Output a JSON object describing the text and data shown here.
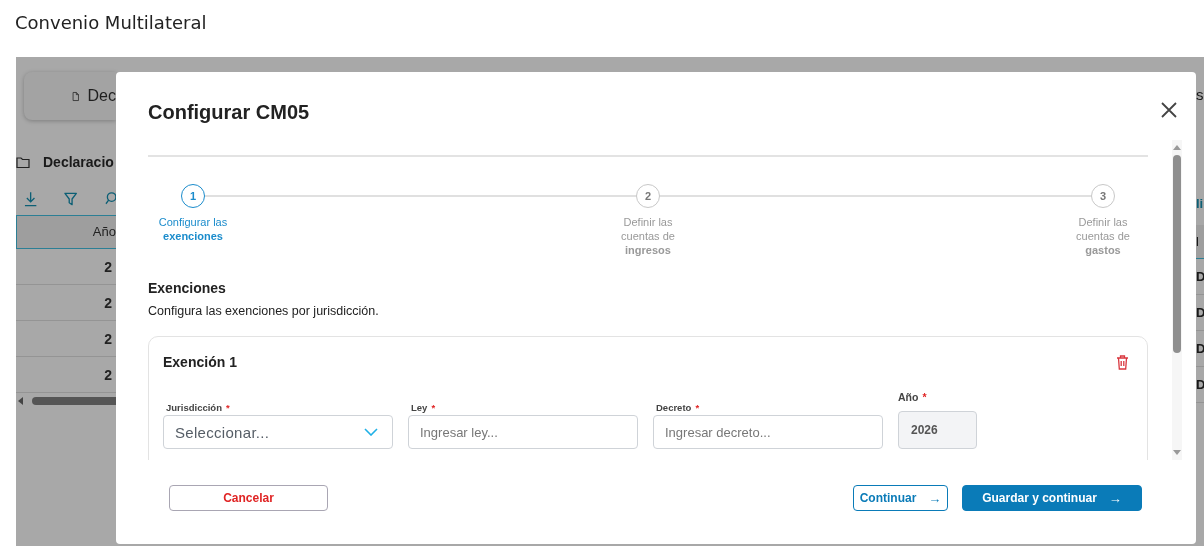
{
  "page": {
    "title": "Convenio Multilateral"
  },
  "background": {
    "card_label": "Dec",
    "section_title": "Declaracio",
    "table_header": "Año",
    "rows": [
      "2",
      "2",
      "2",
      "2"
    ],
    "right_card_text": "s",
    "right_link": "li",
    "right_header": "l",
    "right_rows": [
      "D",
      "D",
      "D",
      "D"
    ]
  },
  "modal": {
    "title": "Configurar CM05",
    "steps": [
      {
        "number": "1",
        "label": "Configurar las **exenciones**",
        "selected": true
      },
      {
        "number": "2",
        "label": "Definir las cuentas de **ingresos**",
        "selected": false
      },
      {
        "number": "3",
        "label": "Definir las cuentas de **gastos**",
        "selected": false
      }
    ],
    "section": {
      "title": "Exenciones",
      "description": "Configura las exenciones por jurisdicción."
    },
    "exemptions": [
      {
        "title": "Exención 1",
        "fields": [
          {
            "kind": "select",
            "label": "Jurisdicción",
            "required_mark": "*",
            "placeholder": "Seleccionar..."
          },
          {
            "kind": "text",
            "label": "Ley",
            "required_mark": "*",
            "placeholder": "Ingresar ley..."
          },
          {
            "kind": "text",
            "label": "Decreto",
            "required_mark": "*",
            "placeholder": "Ingresar decreto..."
          },
          {
            "kind": "readonly",
            "label": "Año",
            "required_mark": "*",
            "value": "2026"
          }
        ]
      }
    ],
    "buttons": [
      {
        "kind": "cancel",
        "label": "Cancelar"
      },
      {
        "kind": "outline",
        "label": "Continuar",
        "arrow": "→"
      },
      {
        "kind": "primary",
        "label": "Guardar y continuar",
        "arrow": "→"
      }
    ]
  }
}
